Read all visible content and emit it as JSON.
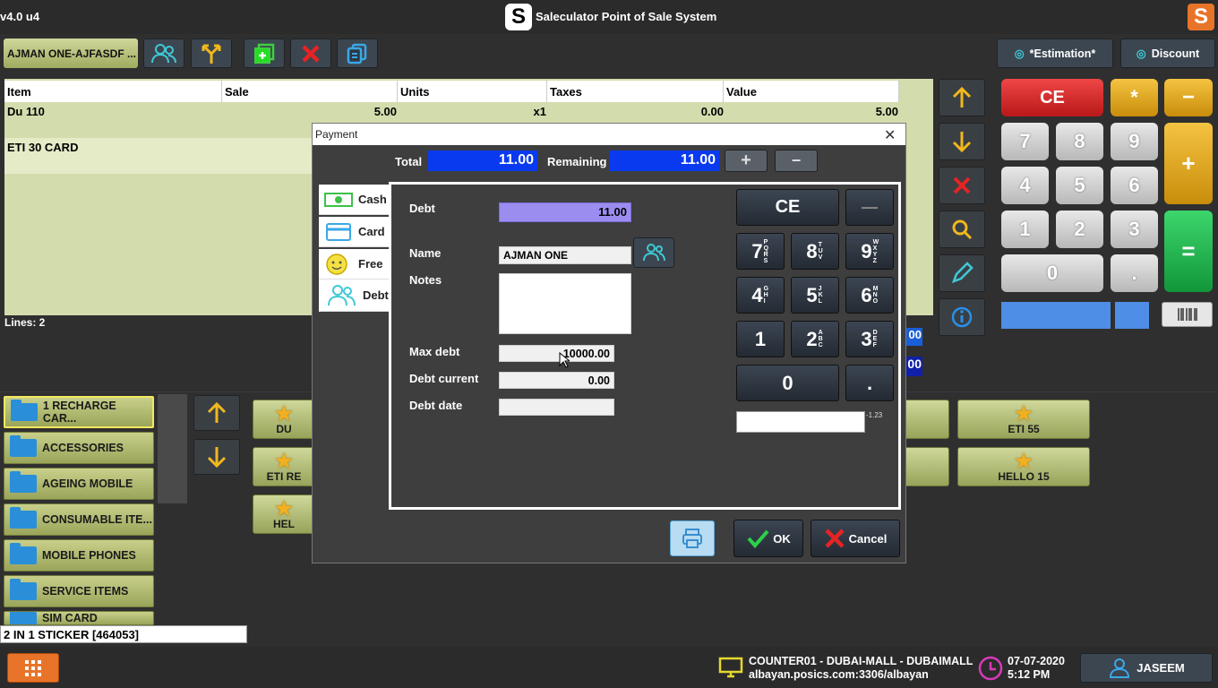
{
  "titlebar": {
    "version": "v4.0 u4",
    "title": "Saleculator Point of Sale System",
    "logo_letter": "S"
  },
  "toolbar": {
    "customer_ticket": "AJMAN ONE-AJFASDF ...",
    "estimation_label": "*Estimation*",
    "discount_label": "Discount"
  },
  "grid": {
    "headers": [
      "Item",
      "Sale",
      "Units",
      "Taxes",
      "Value"
    ],
    "rows": [
      {
        "item": "Du 110",
        "sale": "5.00",
        "units": "x1",
        "taxes": "0.00",
        "value": "5.00"
      },
      {
        "item": "ETI 30 CARD",
        "sale": "",
        "units": "",
        "taxes": "",
        "value": ""
      }
    ],
    "lines_label": "Lines: 2"
  },
  "side_peek": {
    "a": "00",
    "b": "00"
  },
  "keypad": {
    "ce": "CE",
    "star": "*",
    "minus": "−",
    "plus": "+",
    "equals": "=",
    "keys": [
      "7",
      "8",
      "9",
      "4",
      "5",
      "6",
      "1",
      "2",
      "3"
    ],
    "zero": "0",
    "dot": "."
  },
  "categories": [
    "1 RECHARGE CAR...",
    "ACCESSORIES",
    "AGEING MOBILE",
    "CONSUMABLE ITE...",
    "MOBILE PHONES",
    "SERVICE ITEMS",
    "SIM CARD"
  ],
  "products": {
    "col1": [
      "DU",
      "ETI RE",
      "HEL"
    ],
    "right": [
      "ETI 55",
      "HELLO 15"
    ]
  },
  "search_value": "2 IN 1 STICKER [464053]",
  "payment": {
    "title": "Payment",
    "total_label": "Total",
    "total": "11.00",
    "remaining_label": "Remaining",
    "remaining": "11.00",
    "tabs": [
      "Cash",
      "Card",
      "Free",
      "Debt"
    ],
    "debt_label": "Debt",
    "debt": "11.00",
    "name_label": "Name",
    "name": "AJMAN ONE",
    "notes_label": "Notes",
    "max_debt_label": "Max debt",
    "max_debt": "10000.00",
    "debt_current_label": "Debt current",
    "debt_current": "0.00",
    "debt_date_label": "Debt date",
    "ce": "CE",
    "dash": "—",
    "keys": [
      {
        "n": "7",
        "s": "PQRS"
      },
      {
        "n": "8",
        "s": "TUV"
      },
      {
        "n": "9",
        "s": "WXYZ"
      },
      {
        "n": "4",
        "s": "GHI"
      },
      {
        "n": "5",
        "s": "JKL"
      },
      {
        "n": "6",
        "s": "MNO"
      },
      {
        "n": "1",
        "s": ""
      },
      {
        "n": "2",
        "s": "ABC"
      },
      {
        "n": "3",
        "s": "DEF"
      }
    ],
    "zero": "0",
    "dot": ".",
    "hint": "-1.23",
    "ok": "OK",
    "cancel": "Cancel"
  },
  "status": {
    "location": "COUNTER01 - DUBAI-MALL - DUBAIMALL",
    "host": "albayan.posics.com:3306/albayan",
    "date": "07-07-2020",
    "time": "5:12 PM",
    "user": "JASEEM"
  }
}
